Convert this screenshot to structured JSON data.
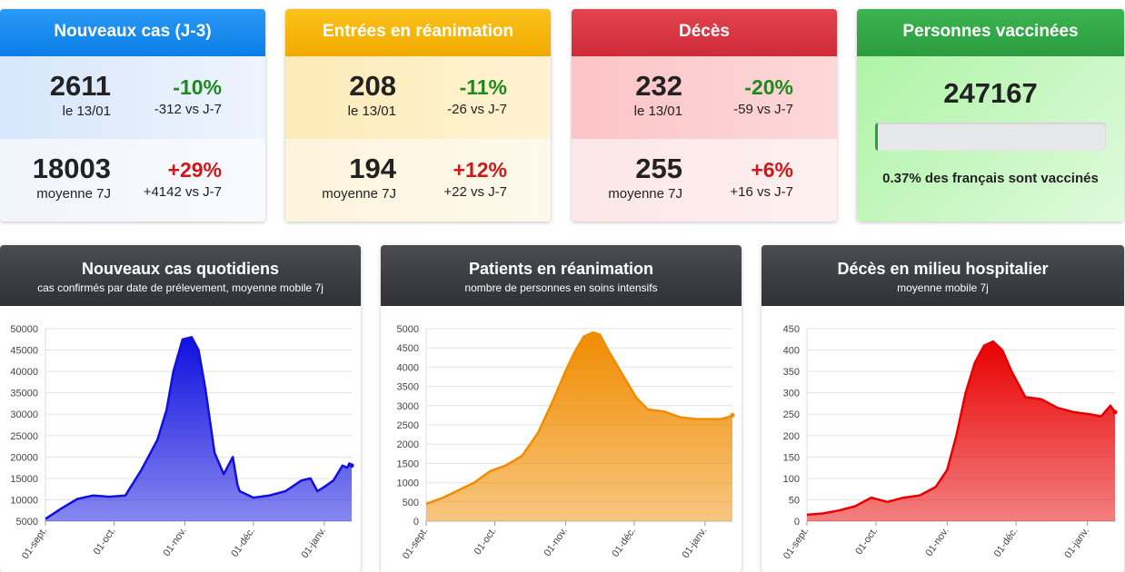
{
  "cards": [
    {
      "title": "Nouveaux cas (J-3)",
      "head_color": "#1a8cf0",
      "top": {
        "value": "2611",
        "label": "le 13/01",
        "pct": "-10%",
        "delta": "-312 vs J-7",
        "trend": "neg"
      },
      "bottom": {
        "value": "18003",
        "label": "moyenne 7J",
        "pct": "+29%",
        "delta": "+4142 vs J-7",
        "trend": "pos"
      }
    },
    {
      "title": "Entrées en réanimation",
      "head_color": "#f5b400",
      "top": {
        "value": "208",
        "label": "le 13/01",
        "pct": "-11%",
        "delta": "-26 vs J-7",
        "trend": "neg"
      },
      "bottom": {
        "value": "194",
        "label": "moyenne 7J",
        "pct": "+12%",
        "delta": "+22 vs J-7",
        "trend": "pos"
      }
    },
    {
      "title": "Décès",
      "head_color": "#d9343f",
      "top": {
        "value": "232",
        "label": "le 13/01",
        "pct": "-20%",
        "delta": "-59 vs J-7",
        "trend": "neg"
      },
      "bottom": {
        "value": "255",
        "label": "moyenne 7J",
        "pct": "+6%",
        "delta": "+16 vs J-7",
        "trend": "pos"
      }
    }
  ],
  "vaccine": {
    "title": "Personnes vaccinées",
    "value": "247167",
    "progress_pct": 0.37,
    "caption": "0.37% des français sont vaccinés"
  },
  "panels": [
    {
      "title": "Nouveaux cas quotidiens",
      "subtitle": "cas confirmés par date de prélevement, moyenne mobile 7j"
    },
    {
      "title": "Patients en réanimation",
      "subtitle": "nombre de personnes en soins intensifs"
    },
    {
      "title": "Décès en milieu hospitalier",
      "subtitle": "moyenne mobile 7j"
    }
  ],
  "chart_data": [
    {
      "type": "area",
      "title": "Nouveaux cas quotidiens",
      "color": "#1010e0",
      "ylim": [
        5000,
        50000
      ],
      "yticks": [
        5000,
        10000,
        15000,
        20000,
        25000,
        30000,
        35000,
        40000,
        45000,
        50000
      ],
      "xticks": [
        "01-sept.",
        "01-oct.",
        "01-nov.",
        "01-déc.",
        "01-janv."
      ],
      "x": [
        "2020-09-01",
        "2020-09-08",
        "2020-09-15",
        "2020-09-22",
        "2020-09-29",
        "2020-10-06",
        "2020-10-13",
        "2020-10-20",
        "2020-10-24",
        "2020-10-27",
        "2020-10-31",
        "2020-11-04",
        "2020-11-07",
        "2020-11-10",
        "2020-11-14",
        "2020-11-18",
        "2020-11-22",
        "2020-11-24",
        "2020-11-25",
        "2020-12-01",
        "2020-12-08",
        "2020-12-15",
        "2020-12-22",
        "2020-12-26",
        "2020-12-29",
        "2021-01-01",
        "2021-01-05",
        "2021-01-09",
        "2021-01-11",
        "2021-01-12",
        "2021-01-13"
      ],
      "y": [
        5500,
        8000,
        10200,
        11000,
        10700,
        11000,
        17000,
        24000,
        31000,
        40000,
        47500,
        48000,
        45000,
        36000,
        21000,
        16000,
        20000,
        13500,
        12000,
        10500,
        11000,
        12000,
        14500,
        15000,
        12000,
        13000,
        14500,
        18000,
        17500,
        18500,
        18003
      ]
    },
    {
      "type": "area",
      "title": "Patients en réanimation",
      "color": "#f08c00",
      "ylim": [
        0,
        5000
      ],
      "yticks": [
        0,
        500,
        1000,
        1500,
        2000,
        2500,
        3000,
        3500,
        4000,
        4500,
        5000
      ],
      "xticks": [
        "01-sept.",
        "01-oct.",
        "01-nov.",
        "01-déc.",
        "01-janv."
      ],
      "x": [
        "2020-09-01",
        "2020-09-08",
        "2020-09-15",
        "2020-09-22",
        "2020-09-29",
        "2020-10-06",
        "2020-10-13",
        "2020-10-20",
        "2020-10-27",
        "2020-11-01",
        "2020-11-05",
        "2020-11-09",
        "2020-11-13",
        "2020-11-16",
        "2020-11-20",
        "2020-11-24",
        "2020-11-28",
        "2020-12-02",
        "2020-12-07",
        "2020-12-14",
        "2020-12-21",
        "2020-12-28",
        "2021-01-04",
        "2021-01-08",
        "2021-01-11",
        "2021-01-13"
      ],
      "y": [
        450,
        600,
        800,
        1000,
        1300,
        1450,
        1700,
        2300,
        3200,
        3900,
        4400,
        4800,
        4900,
        4850,
        4400,
        4000,
        3600,
        3200,
        2900,
        2850,
        2700,
        2650,
        2650,
        2650,
        2700,
        2750
      ]
    },
    {
      "type": "area",
      "title": "Décès en milieu hospitalier",
      "color": "#e80000",
      "ylim": [
        0,
        450
      ],
      "yticks": [
        0,
        50,
        100,
        150,
        200,
        250,
        300,
        350,
        400,
        450
      ],
      "xticks": [
        "01-sept.",
        "01-oct.",
        "01-nov.",
        "01-déc.",
        "01-janv."
      ],
      "x": [
        "2020-09-01",
        "2020-09-08",
        "2020-09-15",
        "2020-09-22",
        "2020-09-29",
        "2020-10-06",
        "2020-10-13",
        "2020-10-20",
        "2020-10-27",
        "2020-11-01",
        "2020-11-05",
        "2020-11-09",
        "2020-11-13",
        "2020-11-17",
        "2020-11-21",
        "2020-11-25",
        "2020-11-29",
        "2020-12-05",
        "2020-12-12",
        "2020-12-19",
        "2020-12-26",
        "2021-01-02",
        "2021-01-07",
        "2021-01-11",
        "2021-01-13"
      ],
      "y": [
        15,
        18,
        25,
        35,
        55,
        45,
        55,
        60,
        80,
        120,
        200,
        300,
        370,
        410,
        420,
        400,
        350,
        290,
        285,
        265,
        255,
        250,
        245,
        270,
        255
      ]
    }
  ]
}
